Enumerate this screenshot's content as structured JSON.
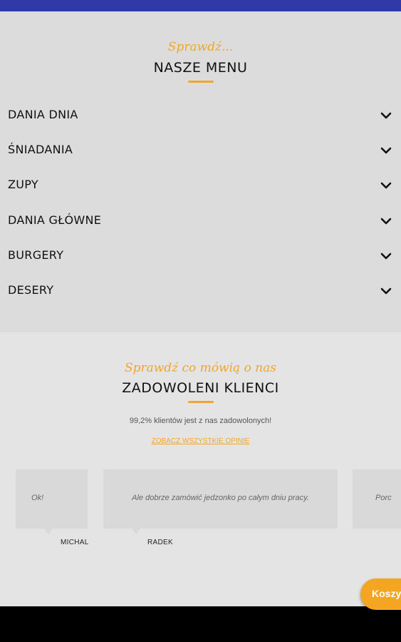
{
  "menu": {
    "script_title": "Sprawdź...",
    "title": "NASZE MENU",
    "items": [
      {
        "label": "DANIA DNIA"
      },
      {
        "label": "ŚNIADANIA"
      },
      {
        "label": "ZUPY"
      },
      {
        "label": "DANIA GŁÓWNE"
      },
      {
        "label": "BURGERY"
      },
      {
        "label": "DESERY"
      }
    ]
  },
  "reviews": {
    "script_title": "Sprawdź co mówią o nas",
    "title": "ZADOWOLENI KLIENCI",
    "summary": "99,2% klientów jest z nas zadowolonych!",
    "all_link": "ZOBACZ WSZYSTKIE OPINIE",
    "cards": [
      {
        "text": "Ok!",
        "author": "MICHAL"
      },
      {
        "text": "Ale dobrze zamówić jedzonko po całym dniu pracy.",
        "author": "RADEK"
      },
      {
        "text": "Porc",
        "author": ""
      }
    ]
  },
  "cart": {
    "label": "Koszyk"
  },
  "colors": {
    "accent": "#f2a52a",
    "top_bar": "#2f3aa8",
    "menu_bg": "#dcdcdc",
    "reviews_bg": "#e4e4e4"
  }
}
